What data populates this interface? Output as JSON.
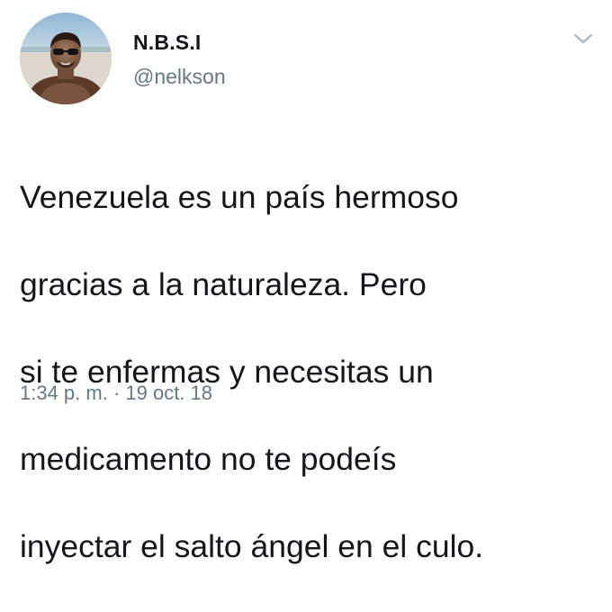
{
  "user": {
    "display_name": "N.B.S.I",
    "handle": "@nelkson",
    "avatar_icon": "profile-photo"
  },
  "tweet": {
    "lines": [
      "Venezuela es un país hermoso",
      "gracias a la naturaleza. Pero",
      "si te enfermas y necesitas un",
      "medicamento no te podeís",
      "inyectar el salto ángel en el culo."
    ],
    "time": "1:34 p. m.",
    "separator": " · ",
    "date": "19 oct. 18"
  },
  "menu": {
    "icon": "chevron-down-icon"
  },
  "colors": {
    "text": "#14171a",
    "secondary": "#657786",
    "chevron": "#aab8c2"
  }
}
